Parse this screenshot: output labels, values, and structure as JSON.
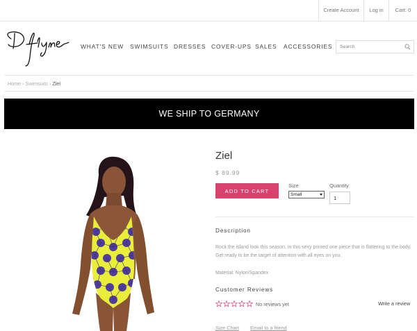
{
  "topbar": {
    "create_account": "Create Account",
    "login": "Log in",
    "cart": "Cart: 0"
  },
  "header": {
    "logo_text": "Dflyne",
    "nav": [
      "WHAT'S NEW",
      "SWIMSUITS",
      "DRESSES",
      "COVER-UPS",
      "SALES",
      "ACCESSORIES"
    ],
    "search_placeholder": "Search"
  },
  "breadcrumb": {
    "items": [
      "Home",
      "Swimsuits"
    ],
    "separator": "›",
    "current": "Ziel"
  },
  "banner": {
    "text": "WE SHIP TO GERMANY"
  },
  "product": {
    "title": "Ziel",
    "price": "$ 89.99",
    "add_to_cart": "ADD TO CART",
    "size_label": "Size",
    "size_value": "Small",
    "quantity_label": "Quantity",
    "quantity_value": "1",
    "description_heading": "Description",
    "description": "Rock the island look this season, in this sexy printed one piece that is flattering to the body. Get ready to be the target of attention with all eyes on you.",
    "material": "Material: Nylon/Spandex",
    "reviews_heading": "Customer Reviews",
    "rating": 0,
    "rating_max": 5,
    "no_reviews": "No reviews yet",
    "write_review": "Write a review",
    "size_chart_link": "Size Chart",
    "email_friend_link": "Email to a friend"
  },
  "colors": {
    "accent": "#d9426c",
    "banner_bg": "#000000",
    "star": "#d9426c",
    "swimsuit_yellow": "#e8ee3a",
    "swimsuit_purple": "#4f3c9c"
  }
}
